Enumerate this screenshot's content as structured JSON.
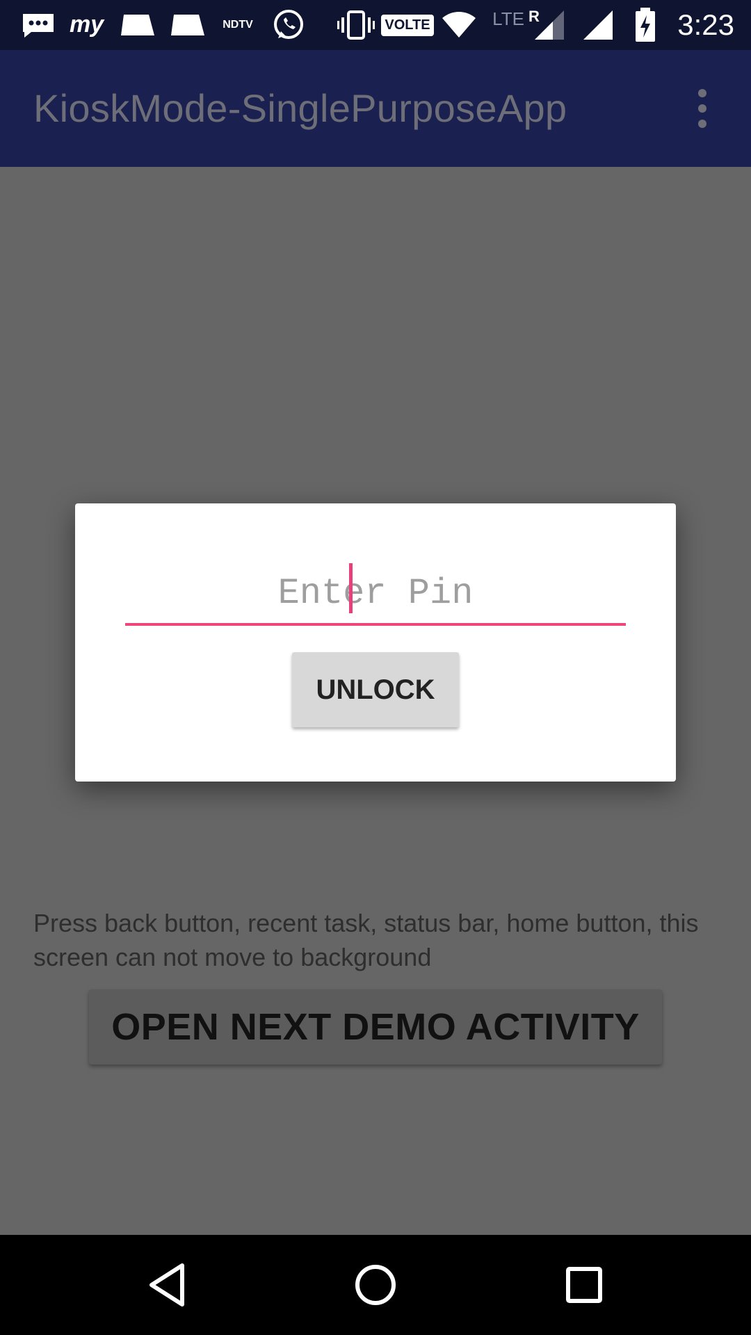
{
  "status_bar": {
    "time": "3:23",
    "icons": [
      "messages-icon",
      "myntra-icon",
      "notification-icon",
      "notification-icon",
      "ndtv-icon",
      "whatsapp-icon",
      "vibrate-icon",
      "volte-icon",
      "wifi-icon",
      "lte-roaming-icon",
      "cell-signal-icon",
      "battery-charging-icon"
    ],
    "ndtv_label": "NDTV",
    "volte_label": "VOLTE",
    "lte_label": "LTE",
    "roaming_label": "R"
  },
  "app_bar": {
    "title": "KioskMode-SinglePurposeApp",
    "menu_icon": "overflow-menu-icon"
  },
  "main": {
    "info_text": "Press back button, recent task, status bar, home button, this screen can not move to background",
    "demo_button_label": "OPEN NEXT DEMO ACTIVITY"
  },
  "dialog": {
    "pin_input": {
      "placeholder": "Enter Pin",
      "value": ""
    },
    "unlock_label": "UNLOCK"
  },
  "nav_bar": {
    "icons": [
      "back-icon",
      "home-icon",
      "recents-icon"
    ]
  },
  "colors": {
    "status_bar": "#0f1530",
    "app_bar": "#1a2150",
    "scrim_background": "#666666",
    "accent": "#f0457a",
    "dialog_background": "#ffffff",
    "button": "#d8d8d8",
    "nav_bar": "#000000"
  }
}
